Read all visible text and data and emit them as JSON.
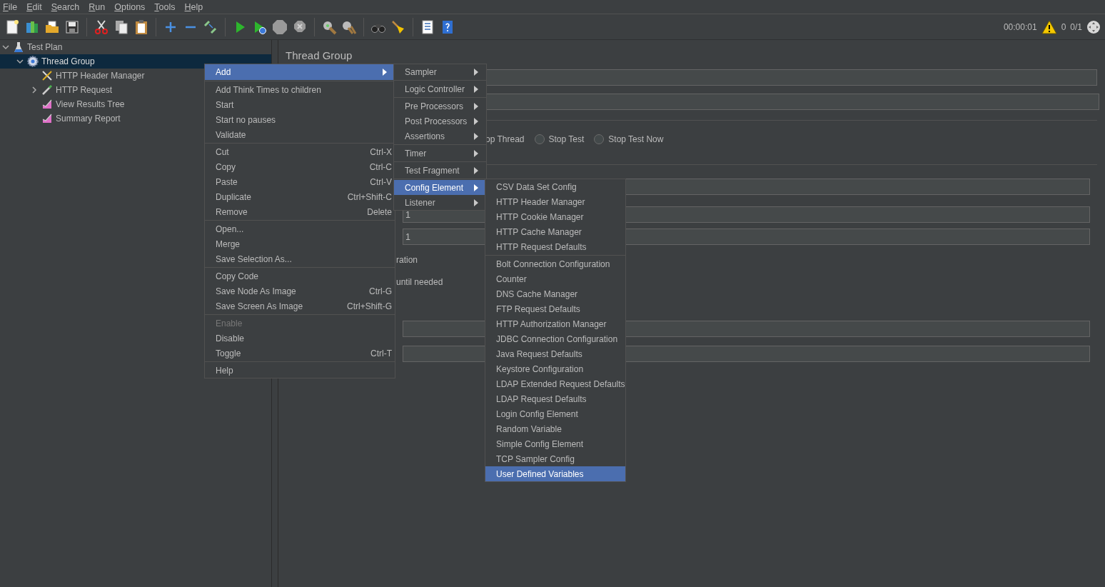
{
  "menu_bar": [
    "File",
    "Edit",
    "Search",
    "Run",
    "Options",
    "Tools",
    "Help"
  ],
  "status": {
    "elapsed": "00:00:01",
    "warnings": "0",
    "threads": "0/1"
  },
  "tree": [
    {
      "label": "Test Plan",
      "kind": "plan",
      "expanded": true,
      "selected": false,
      "children": [
        {
          "label": "Thread Group",
          "kind": "thread-group",
          "expanded": true,
          "selected": true,
          "children": [
            {
              "label": "HTTP Header Manager",
              "kind": "config",
              "selected": false
            },
            {
              "label": "HTTP Request",
              "kind": "sampler",
              "expanded": false,
              "selected": false
            },
            {
              "label": "View Results Tree",
              "kind": "listener",
              "selected": false
            },
            {
              "label": "Summary Report",
              "kind": "listener",
              "selected": false
            }
          ]
        }
      ]
    }
  ],
  "content": {
    "title": "Thread Group",
    "rows": [
      {
        "kind": "field"
      },
      {
        "kind": "field"
      },
      {
        "kind": "divider"
      },
      {
        "kind": "radios",
        "cut_label": "op Thread",
        "options": [
          {
            "label": "Stop Test",
            "selected": false
          },
          {
            "label": "Stop Test Now",
            "selected": false
          }
        ]
      },
      {
        "kind": "divider"
      },
      {
        "kind": "field"
      },
      {
        "kind": "field",
        "value": "1"
      },
      {
        "kind": "field",
        "value": "1"
      },
      {
        "kind": "text",
        "text": "ration"
      },
      {
        "kind": "text",
        "text": "until needed"
      },
      {
        "kind": "field"
      },
      {
        "kind": "field"
      }
    ]
  },
  "context_menu": [
    {
      "kind": "submenu",
      "label": "Add",
      "selected": true,
      "disabled": false
    },
    {
      "kind": "separator"
    },
    {
      "kind": "item",
      "label": "Add Think Times to children",
      "selected": false,
      "disabled": false
    },
    {
      "kind": "item",
      "label": "Start",
      "selected": false,
      "disabled": false
    },
    {
      "kind": "item",
      "label": "Start no pauses",
      "selected": false,
      "disabled": false
    },
    {
      "kind": "item",
      "label": "Validate",
      "selected": false,
      "disabled": false
    },
    {
      "kind": "separator"
    },
    {
      "kind": "item",
      "label": "Cut",
      "shortcut": "Ctrl-X",
      "selected": false,
      "disabled": false
    },
    {
      "kind": "item",
      "label": "Copy",
      "shortcut": "Ctrl-C",
      "selected": false,
      "disabled": false
    },
    {
      "kind": "item",
      "label": "Paste",
      "shortcut": "Ctrl-V",
      "selected": false,
      "disabled": false
    },
    {
      "kind": "item",
      "label": "Duplicate",
      "shortcut": "Ctrl+Shift-C",
      "selected": false,
      "disabled": false
    },
    {
      "kind": "item",
      "label": "Remove",
      "shortcut": "Delete",
      "selected": false,
      "disabled": false
    },
    {
      "kind": "separator"
    },
    {
      "kind": "item",
      "label": "Open...",
      "selected": false,
      "disabled": false
    },
    {
      "kind": "item",
      "label": "Merge",
      "selected": false,
      "disabled": false
    },
    {
      "kind": "item",
      "label": "Save Selection As...",
      "selected": false,
      "disabled": false
    },
    {
      "kind": "separator"
    },
    {
      "kind": "item",
      "label": "Copy Code",
      "selected": false,
      "disabled": false
    },
    {
      "kind": "item",
      "label": "Save Node As Image",
      "shortcut": "Ctrl-G",
      "selected": false,
      "disabled": false
    },
    {
      "kind": "item",
      "label": "Save Screen As Image",
      "shortcut": "Ctrl+Shift-G",
      "selected": false,
      "disabled": false
    },
    {
      "kind": "separator"
    },
    {
      "kind": "item",
      "label": "Enable",
      "selected": false,
      "disabled": true
    },
    {
      "kind": "item",
      "label": "Disable",
      "selected": false,
      "disabled": false
    },
    {
      "kind": "item",
      "label": "Toggle",
      "shortcut": "Ctrl-T",
      "selected": false,
      "disabled": false
    },
    {
      "kind": "separator"
    },
    {
      "kind": "item",
      "label": "Help",
      "selected": false,
      "disabled": false
    }
  ],
  "add_submenu": [
    {
      "kind": "submenu",
      "label": "Sampler",
      "selected": false
    },
    {
      "kind": "separator"
    },
    {
      "kind": "submenu",
      "label": "Logic Controller",
      "selected": false
    },
    {
      "kind": "separator"
    },
    {
      "kind": "submenu",
      "label": "Pre Processors",
      "selected": false
    },
    {
      "kind": "submenu",
      "label": "Post Processors",
      "selected": false
    },
    {
      "kind": "submenu",
      "label": "Assertions",
      "selected": false
    },
    {
      "kind": "separator"
    },
    {
      "kind": "submenu",
      "label": "Timer",
      "selected": false
    },
    {
      "kind": "separator"
    },
    {
      "kind": "submenu",
      "label": "Test Fragment",
      "selected": false
    },
    {
      "kind": "separator"
    },
    {
      "kind": "submenu",
      "label": "Config Element",
      "selected": true
    },
    {
      "kind": "submenu",
      "label": "Listener",
      "selected": false
    }
  ],
  "config_submenu": [
    {
      "kind": "item",
      "label": "CSV Data Set Config",
      "selected": false
    },
    {
      "kind": "item",
      "label": "HTTP Header Manager",
      "selected": false
    },
    {
      "kind": "item",
      "label": "HTTP Cookie Manager",
      "selected": false
    },
    {
      "kind": "item",
      "label": "HTTP Cache Manager",
      "selected": false
    },
    {
      "kind": "item",
      "label": "HTTP Request Defaults",
      "selected": false
    },
    {
      "kind": "separator"
    },
    {
      "kind": "item",
      "label": "Bolt Connection Configuration",
      "selected": false
    },
    {
      "kind": "item",
      "label": "Counter",
      "selected": false
    },
    {
      "kind": "item",
      "label": "DNS Cache Manager",
      "selected": false
    },
    {
      "kind": "item",
      "label": "FTP Request Defaults",
      "selected": false
    },
    {
      "kind": "item",
      "label": "HTTP Authorization Manager",
      "selected": false
    },
    {
      "kind": "item",
      "label": "JDBC Connection Configuration",
      "selected": false
    },
    {
      "kind": "item",
      "label": "Java Request Defaults",
      "selected": false
    },
    {
      "kind": "item",
      "label": "Keystore Configuration",
      "selected": false
    },
    {
      "kind": "item",
      "label": "LDAP Extended Request Defaults",
      "selected": false
    },
    {
      "kind": "item",
      "label": "LDAP Request Defaults",
      "selected": false
    },
    {
      "kind": "item",
      "label": "Login Config Element",
      "selected": false
    },
    {
      "kind": "item",
      "label": "Random Variable",
      "selected": false
    },
    {
      "kind": "item",
      "label": "Simple Config Element",
      "selected": false
    },
    {
      "kind": "item",
      "label": "TCP Sampler Config",
      "selected": false
    },
    {
      "kind": "item",
      "label": "User Defined Variables",
      "selected": true
    }
  ]
}
